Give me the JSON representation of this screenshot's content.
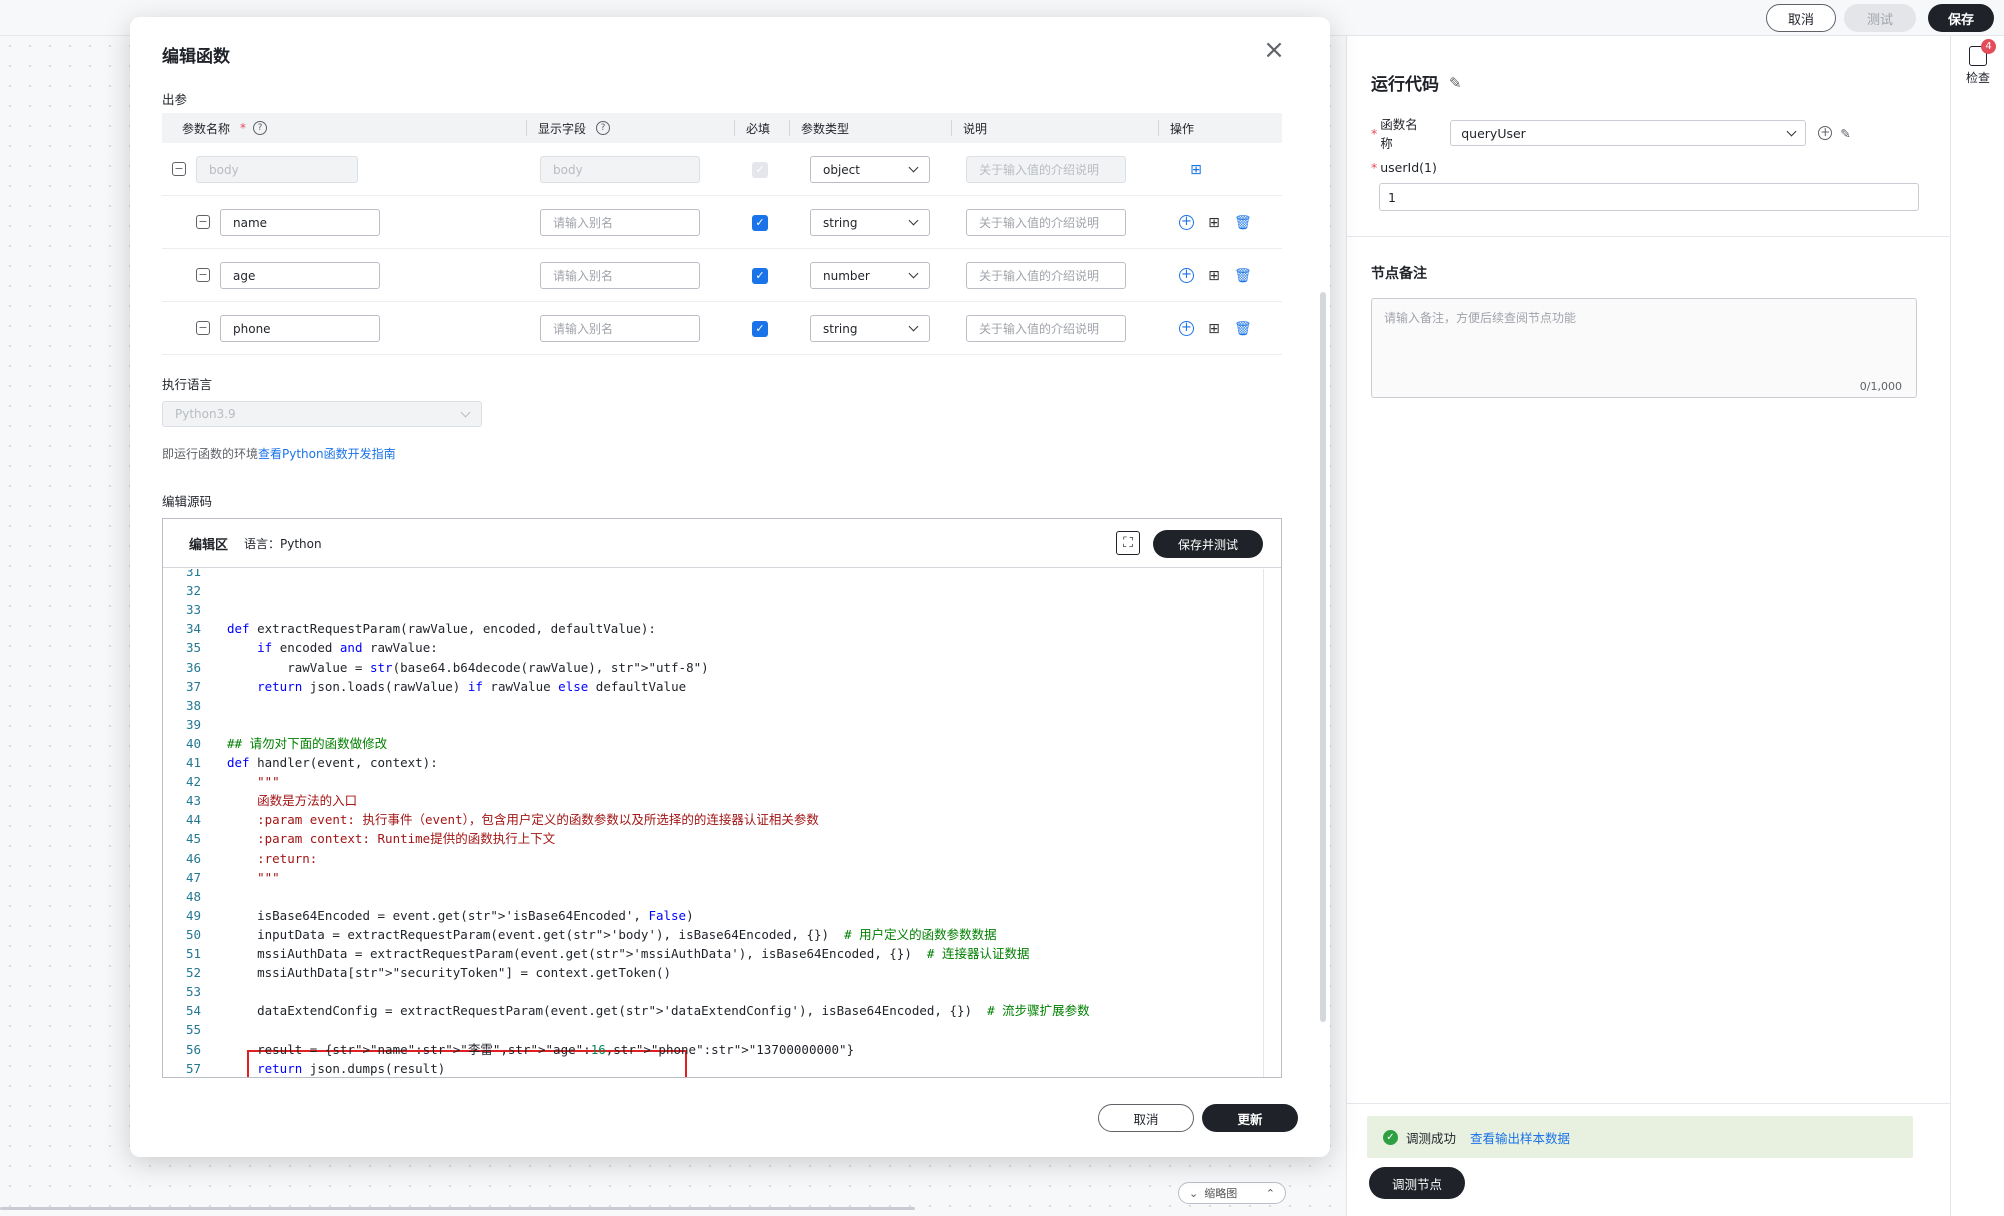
{
  "topbar": {
    "cancel": "取消",
    "test": "测试",
    "save": "保存"
  },
  "canvas": {
    "mini_btn": "缩略图"
  },
  "right_panel": {
    "title": "运行代码",
    "func_label": "函数名称",
    "func_value": "queryUser",
    "param_label": "userId(1)",
    "param_value": "1",
    "note_title": "节点备注",
    "note_placeholder": "请输入备注，方便后续查阅节点功能",
    "note_count": "0/1,000",
    "success_text": "调测成功",
    "success_link": "查看输出样本数据",
    "debug_button": "调测节点"
  },
  "right_strip": {
    "check_label": "检查",
    "badge": "4"
  },
  "modal": {
    "title": "编辑函数",
    "out_params_label": "出参",
    "headers": {
      "name": "参数名称",
      "display": "显示字段",
      "required": "必填",
      "type": "参数类型",
      "desc": "说明",
      "ops": "操作"
    },
    "rows": [
      {
        "name": "body",
        "display": "body",
        "type": "object",
        "desc": "关于输入值的介绍说明"
      },
      {
        "name": "name",
        "display": "请输入别名",
        "type": "string",
        "desc": "关于输入值的介绍说明"
      },
      {
        "name": "age",
        "display": "请输入别名",
        "type": "number",
        "desc": "关于输入值的介绍说明"
      },
      {
        "name": "phone",
        "display": "请输入别名",
        "type": "string",
        "desc": "关于输入值的介绍说明"
      }
    ],
    "exec_lang_label": "执行语言",
    "exec_lang_value": "Python3.9",
    "lang_hint": "即运行函数的环境",
    "lang_hint_link": "查看Python函数开发指南",
    "source_label": "编辑源码",
    "editor": {
      "tab": "编辑区",
      "lang": "语言：Python",
      "save_test": "保存并测试",
      "fullscreen_glyph": "⛶",
      "lines": [
        {
          "n": "31",
          "code": ""
        },
        {
          "n": "32",
          "code": ""
        },
        {
          "n": "33",
          "code": ""
        },
        {
          "n": "34",
          "code": "def extractRequestParam(rawValue, encoded, defaultValue):"
        },
        {
          "n": "35",
          "code": "    if encoded and rawValue:"
        },
        {
          "n": "36",
          "code": "        rawValue = str(base64.b64decode(rawValue), \"utf-8\")"
        },
        {
          "n": "37",
          "code": "    return json.loads(rawValue) if rawValue else defaultValue"
        },
        {
          "n": "38",
          "code": ""
        },
        {
          "n": "39",
          "code": ""
        },
        {
          "n": "40",
          "code": "## 请勿对下面的函数做修改"
        },
        {
          "n": "41",
          "code": "def handler(event, context):"
        },
        {
          "n": "42",
          "code": "    \"\"\""
        },
        {
          "n": "43",
          "code": "    函数是方法的入口"
        },
        {
          "n": "44",
          "code": "    :param event: 执行事件（event），包含用户定义的函数参数以及所选择的的连接器认证相关参数"
        },
        {
          "n": "45",
          "code": "    :param context: Runtime提供的函数执行上下文"
        },
        {
          "n": "46",
          "code": "    :return:"
        },
        {
          "n": "47",
          "code": "    \"\"\""
        },
        {
          "n": "48",
          "code": ""
        },
        {
          "n": "49",
          "code": "    isBase64Encoded = event.get('isBase64Encoded', False)"
        },
        {
          "n": "50",
          "code": "    inputData = extractRequestParam(event.get('body'), isBase64Encoded, {})  # 用户定义的函数参数数据"
        },
        {
          "n": "51",
          "code": "    mssiAuthData = extractRequestParam(event.get('mssiAuthData'), isBase64Encoded, {})  # 连接器认证数据"
        },
        {
          "n": "52",
          "code": "    mssiAuthData[\"securityToken\"] = context.getToken()"
        },
        {
          "n": "53",
          "code": ""
        },
        {
          "n": "54",
          "code": "    dataExtendConfig = extractRequestParam(event.get('dataExtendConfig'), isBase64Encoded, {})  # 流步骤扩展参数"
        },
        {
          "n": "55",
          "code": ""
        },
        {
          "n": "56",
          "code": "    result = {\"name\":\"李雷\",\"age\":16,\"phone\":\"13700000000\"}"
        },
        {
          "n": "57",
          "code": "    return json.dumps(result)"
        }
      ]
    },
    "cancel": "取消",
    "update": "更新"
  }
}
